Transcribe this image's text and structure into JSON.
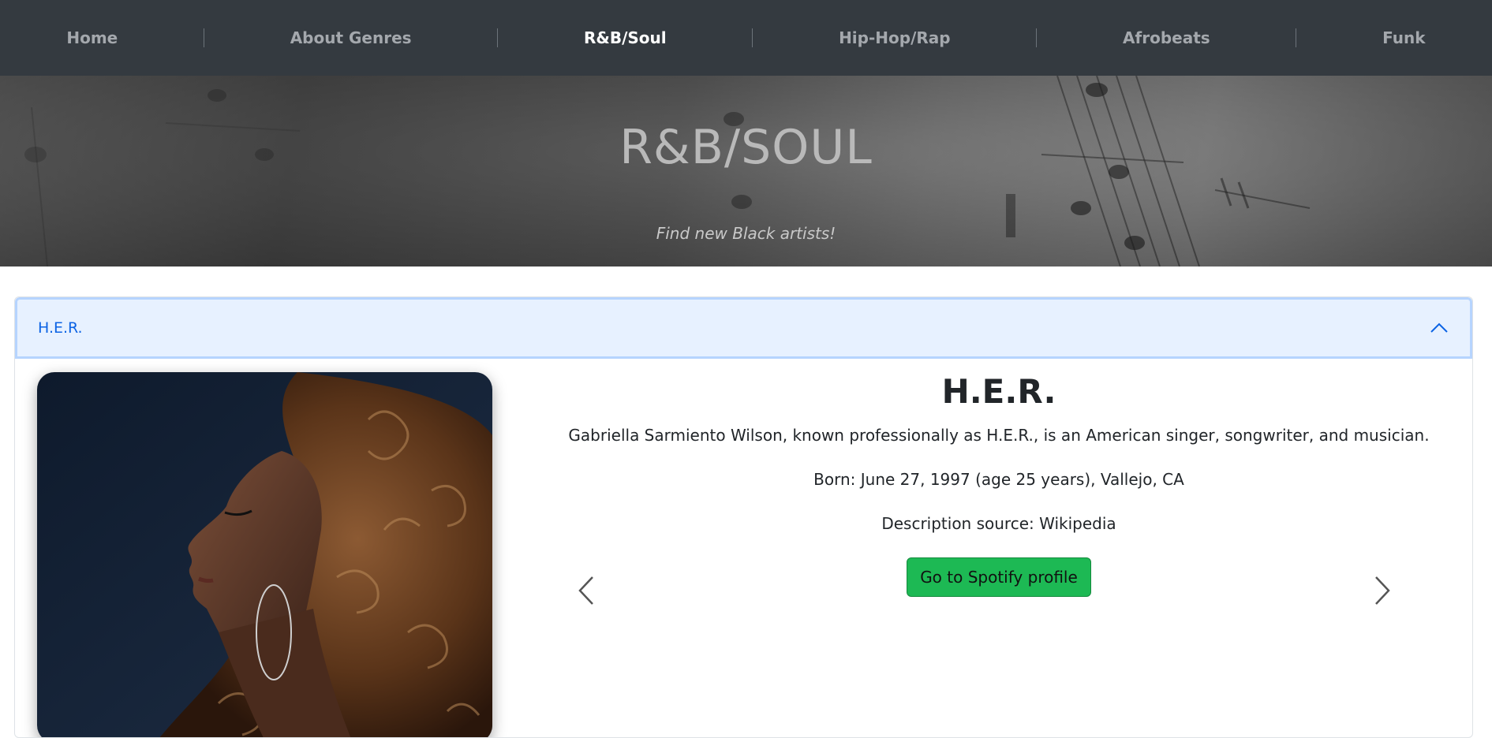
{
  "nav": {
    "items": [
      {
        "label": "Home"
      },
      {
        "label": "About Genres"
      },
      {
        "label": "R&B/Soul"
      },
      {
        "label": "Hip-Hop/Rap"
      },
      {
        "label": "Afrobeats"
      },
      {
        "label": "Funk"
      }
    ],
    "active": "R&B/Soul"
  },
  "hero": {
    "title": "R&B/SOUL",
    "subtitle": "Find new Black artists!"
  },
  "accordion": {
    "header_label": "H.E.R.",
    "expanded": true
  },
  "artist": {
    "name": "H.E.R.",
    "description": "Gabriella Sarmiento Wilson, known professionally as H.E.R., is an American singer, songwriter, and musician.",
    "born": "Born: June 27, 1997 (age 25 years), Vallejo, CA",
    "source": "Description source: Wikipedia",
    "spotify_label": "Go to Spotify profile"
  },
  "icons": {
    "accordion_toggle": "chevron-up-icon",
    "prev": "chevron-left-icon",
    "next": "chevron-right-icon"
  },
  "colors": {
    "nav_bg": "#343a40",
    "accent_blue": "#0c63e4",
    "accordion_bg": "#e7f1ff",
    "spotify_green": "#1db954"
  }
}
